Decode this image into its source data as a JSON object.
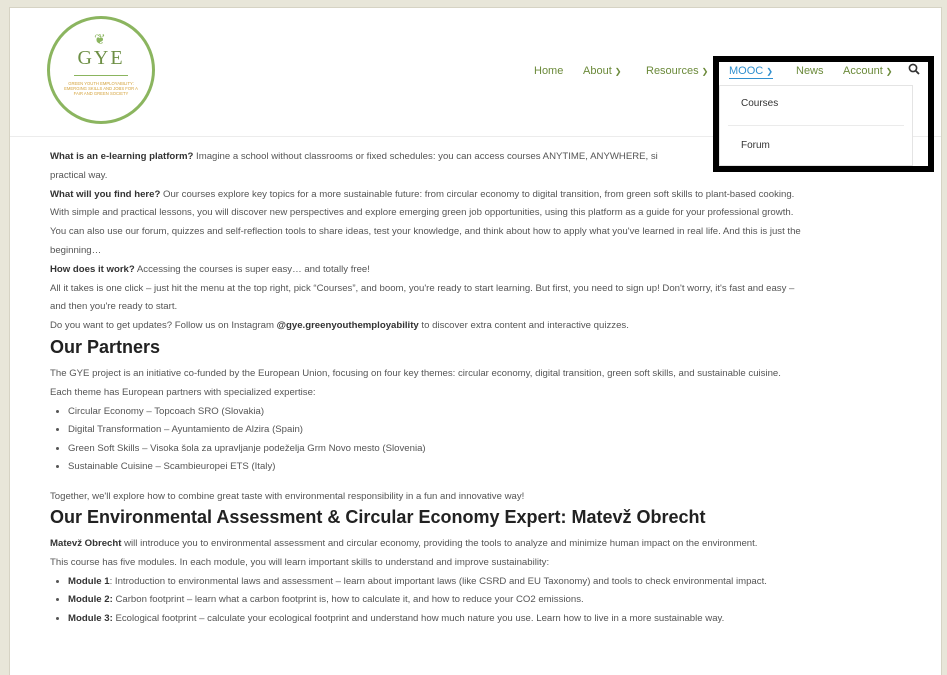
{
  "logo": {
    "text": "GYE",
    "tagline": "GREEN YOUTH EMPLOYABILITY: EMERGING SKILLS AND JOBS FOR A FAIR AND GREEN SOCIETY"
  },
  "nav": {
    "home": "Home",
    "about": "About",
    "resources": "Resources",
    "mooc": "MOOC",
    "news": "News",
    "account": "Account"
  },
  "dropdown": {
    "courses": "Courses",
    "forum": "Forum"
  },
  "intro": {
    "q1": "What is an e-learning platform?",
    "a1": " Imagine a school without classrooms or fixed schedules: you can access courses ANYTIME, ANYWHERE, si",
    "a1b": "practical way.",
    "q2": "What will you find here?",
    "a2": " Our courses explore key topics for a more sustainable future: from circular economy to digital transition, from green soft skills to plant-based cooking.",
    "a2b": "With simple and practical lessons, you will discover new perspectives and explore emerging green job opportunities, using this platform as a guide for your professional growth.",
    "a2c": "You can also use our forum, quizzes and self-reflection tools to share ideas, test your knowledge, and think about how to apply what you've learned in real life. And this is just the",
    "a2d": "beginning…",
    "q3": "How does it work?",
    "a3": " Accessing the courses is super easy… and totally free!",
    "a3b": "All it takes is one click – just hit the menu at the top right, pick “Courses”, and boom, you're ready to start learning. But first, you need to sign up! Don't worry, it's fast and easy –",
    "a3c": "and then you're ready to start.",
    "updates_pre": "Do you want to get updates? Follow us on Instagram ",
    "instagram": "@gye.greenyouthemployability",
    "updates_post": " to discover extra content and interactive quizzes."
  },
  "partners": {
    "heading": "Our Partners",
    "p1": "The GYE project is an initiative co-funded by the European Union, focusing on four key themes: circular economy, digital transition, green soft skills, and sustainable cuisine.",
    "p2": "Each theme has European partners with specialized expertise:",
    "items": [
      "Circular Economy – Topcoach SRO (Slovakia)",
      "Digital Transformation  – Ayuntamiento de Alzira (Spain)",
      "Green Soft Skills – Visoka šola za upravljanje podeželja Grm Novo mesto (Slovenia)",
      "Sustainable Cuisine – Scambieuropei ETS (Italy)"
    ],
    "outro": "Together, we'll explore how to combine great taste with environmental responsibility in a fun and innovative way!"
  },
  "expert": {
    "heading": "Our Environmental Assessment & Circular Economy Expert: Matevž Obrecht",
    "name": "Matevž Obrecht",
    "p1": " will introduce you to environmental assessment and circular economy, providing the tools to analyze and minimize human impact on the environment.",
    "p2": "This course has five modules. In each module, you will learn important skills to understand and improve sustainability:",
    "modules": [
      {
        "label": "Module 1",
        "text": ": Introduction to environmental laws and assessment – learn about important laws (like CSRD and EU Taxonomy) and tools to check environmental impact."
      },
      {
        "label": "Module 2:",
        "text": " Carbon footprint – learn what a carbon footprint is, how to calculate it, and how to reduce your CO2 emissions."
      },
      {
        "label": "Module 3:",
        "text": " Ecological footprint – calculate your ecological footprint and understand how much nature you use. Learn how to live in a more sustainable way."
      }
    ]
  }
}
